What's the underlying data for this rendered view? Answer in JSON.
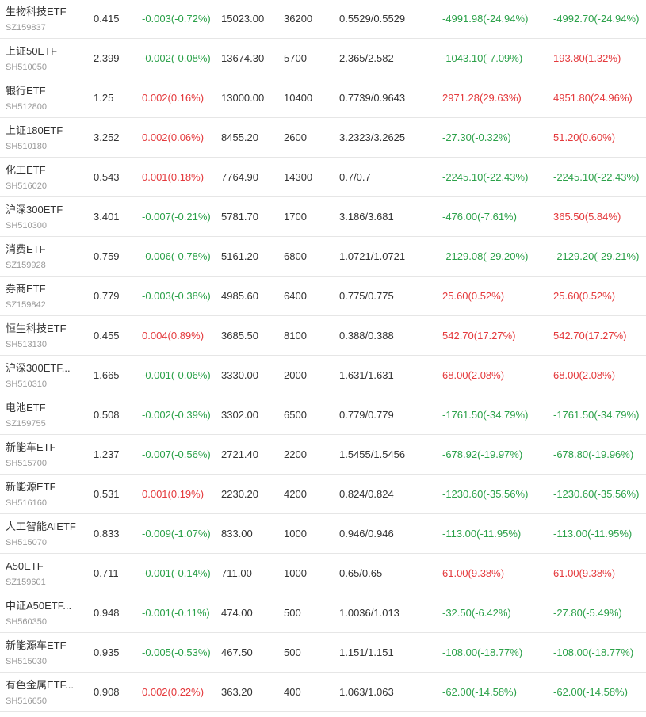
{
  "colors": {
    "up": "#e4393c",
    "down": "#2ba149",
    "text": "#333333",
    "code": "#999999",
    "divider": "#e6e6e6"
  },
  "rows": [
    {
      "name": "生物科技ETF",
      "code": "SZ159837",
      "price": "0.415",
      "change": "-0.003(-0.72%)",
      "change_dir": "down",
      "market_value": "15023.00",
      "quantity": "36200",
      "cost": "0.5529/0.5529",
      "pnl": "-4991.98(-24.94%)",
      "pnl_dir": "down",
      "pnl2": "-4992.70(-24.94%)",
      "pnl2_dir": "down"
    },
    {
      "name": "上证50ETF",
      "code": "SH510050",
      "price": "2.399",
      "change": "-0.002(-0.08%)",
      "change_dir": "down",
      "market_value": "13674.30",
      "quantity": "5700",
      "cost": "2.365/2.582",
      "pnl": "-1043.10(-7.09%)",
      "pnl_dir": "down",
      "pnl2": "193.80(1.32%)",
      "pnl2_dir": "up"
    },
    {
      "name": "银行ETF",
      "code": "SH512800",
      "price": "1.25",
      "change": "0.002(0.16%)",
      "change_dir": "up",
      "market_value": "13000.00",
      "quantity": "10400",
      "cost": "0.7739/0.9643",
      "pnl": "2971.28(29.63%)",
      "pnl_dir": "up",
      "pnl2": "4951.80(24.96%)",
      "pnl2_dir": "up"
    },
    {
      "name": "上证180ETF",
      "code": "SH510180",
      "price": "3.252",
      "change": "0.002(0.06%)",
      "change_dir": "up",
      "market_value": "8455.20",
      "quantity": "2600",
      "cost": "3.2323/3.2625",
      "pnl": "-27.30(-0.32%)",
      "pnl_dir": "down",
      "pnl2": "51.20(0.60%)",
      "pnl2_dir": "up"
    },
    {
      "name": "化工ETF",
      "code": "SH516020",
      "price": "0.543",
      "change": "0.001(0.18%)",
      "change_dir": "up",
      "market_value": "7764.90",
      "quantity": "14300",
      "cost": "0.7/0.7",
      "pnl": "-2245.10(-22.43%)",
      "pnl_dir": "down",
      "pnl2": "-2245.10(-22.43%)",
      "pnl2_dir": "down"
    },
    {
      "name": "沪深300ETF",
      "code": "SH510300",
      "price": "3.401",
      "change": "-0.007(-0.21%)",
      "change_dir": "down",
      "market_value": "5781.70",
      "quantity": "1700",
      "cost": "3.186/3.681",
      "pnl": "-476.00(-7.61%)",
      "pnl_dir": "down",
      "pnl2": "365.50(5.84%)",
      "pnl2_dir": "up"
    },
    {
      "name": "消费ETF",
      "code": "SZ159928",
      "price": "0.759",
      "change": "-0.006(-0.78%)",
      "change_dir": "down",
      "market_value": "5161.20",
      "quantity": "6800",
      "cost": "1.0721/1.0721",
      "pnl": "-2129.08(-29.20%)",
      "pnl_dir": "down",
      "pnl2": "-2129.20(-29.21%)",
      "pnl2_dir": "down"
    },
    {
      "name": "券商ETF",
      "code": "SZ159842",
      "price": "0.779",
      "change": "-0.003(-0.38%)",
      "change_dir": "down",
      "market_value": "4985.60",
      "quantity": "6400",
      "cost": "0.775/0.775",
      "pnl": "25.60(0.52%)",
      "pnl_dir": "up",
      "pnl2": "25.60(0.52%)",
      "pnl2_dir": "up"
    },
    {
      "name": "恒生科技ETF",
      "code": "SH513130",
      "price": "0.455",
      "change": "0.004(0.89%)",
      "change_dir": "up",
      "market_value": "3685.50",
      "quantity": "8100",
      "cost": "0.388/0.388",
      "pnl": "542.70(17.27%)",
      "pnl_dir": "up",
      "pnl2": "542.70(17.27%)",
      "pnl2_dir": "up"
    },
    {
      "name": "沪深300ETF...",
      "code": "SH510310",
      "price": "1.665",
      "change": "-0.001(-0.06%)",
      "change_dir": "down",
      "market_value": "3330.00",
      "quantity": "2000",
      "cost": "1.631/1.631",
      "pnl": "68.00(2.08%)",
      "pnl_dir": "up",
      "pnl2": "68.00(2.08%)",
      "pnl2_dir": "up"
    },
    {
      "name": "电池ETF",
      "code": "SZ159755",
      "price": "0.508",
      "change": "-0.002(-0.39%)",
      "change_dir": "down",
      "market_value": "3302.00",
      "quantity": "6500",
      "cost": "0.779/0.779",
      "pnl": "-1761.50(-34.79%)",
      "pnl_dir": "down",
      "pnl2": "-1761.50(-34.79%)",
      "pnl2_dir": "down"
    },
    {
      "name": "新能车ETF",
      "code": "SH515700",
      "price": "1.237",
      "change": "-0.007(-0.56%)",
      "change_dir": "down",
      "market_value": "2721.40",
      "quantity": "2200",
      "cost": "1.5455/1.5456",
      "pnl": "-678.92(-19.97%)",
      "pnl_dir": "down",
      "pnl2": "-678.80(-19.96%)",
      "pnl2_dir": "down"
    },
    {
      "name": "新能源ETF",
      "code": "SH516160",
      "price": "0.531",
      "change": "0.001(0.19%)",
      "change_dir": "up",
      "market_value": "2230.20",
      "quantity": "4200",
      "cost": "0.824/0.824",
      "pnl": "-1230.60(-35.56%)",
      "pnl_dir": "down",
      "pnl2": "-1230.60(-35.56%)",
      "pnl2_dir": "down"
    },
    {
      "name": "人工智能AIETF",
      "code": "SH515070",
      "price": "0.833",
      "change": "-0.009(-1.07%)",
      "change_dir": "down",
      "market_value": "833.00",
      "quantity": "1000",
      "cost": "0.946/0.946",
      "pnl": "-113.00(-11.95%)",
      "pnl_dir": "down",
      "pnl2": "-113.00(-11.95%)",
      "pnl2_dir": "down"
    },
    {
      "name": "A50ETF",
      "code": "SZ159601",
      "price": "0.711",
      "change": "-0.001(-0.14%)",
      "change_dir": "down",
      "market_value": "711.00",
      "quantity": "1000",
      "cost": "0.65/0.65",
      "pnl": "61.00(9.38%)",
      "pnl_dir": "up",
      "pnl2": "61.00(9.38%)",
      "pnl2_dir": "up"
    },
    {
      "name": "中证A50ETF...",
      "code": "SH560350",
      "price": "0.948",
      "change": "-0.001(-0.11%)",
      "change_dir": "down",
      "market_value": "474.00",
      "quantity": "500",
      "cost": "1.0036/1.013",
      "pnl": "-32.50(-6.42%)",
      "pnl_dir": "down",
      "pnl2": "-27.80(-5.49%)",
      "pnl2_dir": "down"
    },
    {
      "name": "新能源车ETF",
      "code": "SH515030",
      "price": "0.935",
      "change": "-0.005(-0.53%)",
      "change_dir": "down",
      "market_value": "467.50",
      "quantity": "500",
      "cost": "1.151/1.151",
      "pnl": "-108.00(-18.77%)",
      "pnl_dir": "down",
      "pnl2": "-108.00(-18.77%)",
      "pnl2_dir": "down"
    },
    {
      "name": "有色金属ETF...",
      "code": "SH516650",
      "price": "0.908",
      "change": "0.002(0.22%)",
      "change_dir": "up",
      "market_value": "363.20",
      "quantity": "400",
      "cost": "1.063/1.063",
      "pnl": "-62.00(-14.58%)",
      "pnl_dir": "down",
      "pnl2": "-62.00(-14.58%)",
      "pnl2_dir": "down"
    }
  ]
}
